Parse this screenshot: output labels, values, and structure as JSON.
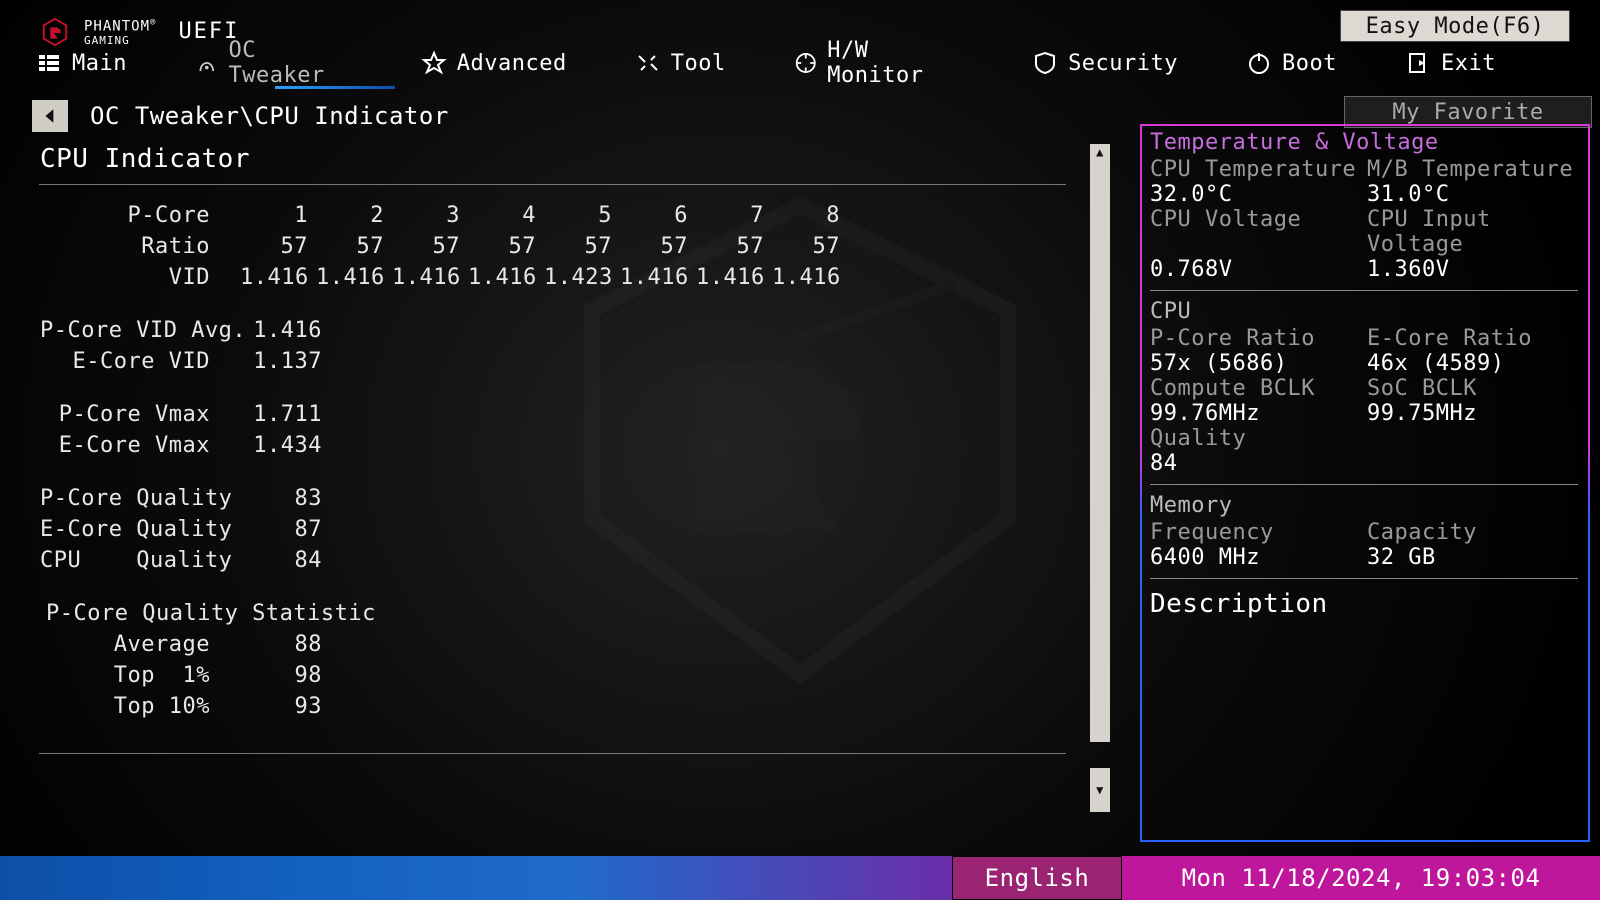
{
  "brand": {
    "line1": "PHANTOM",
    "line2": "GAMING",
    "uefi": "UEFI"
  },
  "easy_mode": "Easy Mode(F6)",
  "tabs": [
    {
      "label": "Main"
    },
    {
      "label": "OC Tweaker"
    },
    {
      "label": "Advanced"
    },
    {
      "label": "Tool"
    },
    {
      "label": "H/W Monitor"
    },
    {
      "label": "Security"
    },
    {
      "label": "Boot"
    },
    {
      "label": "Exit"
    }
  ],
  "active_tab_index": 1,
  "crumb": "OC Tweaker\\CPU Indicator",
  "my_favorite": "My Favorite",
  "section_title": "CPU Indicator",
  "pcore": {
    "header_label": "P-Core",
    "ratio_label": "Ratio",
    "vid_label": "VID",
    "indices": [
      "1",
      "2",
      "3",
      "4",
      "5",
      "6",
      "7",
      "8"
    ],
    "ratios": [
      "57",
      "57",
      "57",
      "57",
      "57",
      "57",
      "57",
      "57"
    ],
    "vids": [
      "1.416",
      "1.416",
      "1.416",
      "1.416",
      "1.423",
      "1.416",
      "1.416",
      "1.416"
    ]
  },
  "pairs": [
    {
      "label": "P-Core VID Avg.",
      "value": "1.416"
    },
    {
      "label": "E-Core VID",
      "value": "1.137"
    },
    {
      "_gap": true
    },
    {
      "label": "P-Core Vmax",
      "value": "1.711"
    },
    {
      "label": "E-Core Vmax",
      "value": "1.434"
    },
    {
      "_gap": true
    },
    {
      "label": "P-Core Quality",
      "value": "83"
    },
    {
      "label": "E-Core Quality",
      "value": "87"
    },
    {
      "label": "CPU    Quality",
      "value": "84"
    },
    {
      "_gap": true
    },
    {
      "label": "P-Core Quality Statistic",
      "value": ""
    },
    {
      "label": "Average",
      "value": "88"
    },
    {
      "label": "Top  1%",
      "value": "98"
    },
    {
      "label": "Top 10%",
      "value": "93"
    }
  ],
  "side": {
    "temp_volt_h": "Temperature & Voltage",
    "cpu_temp_k": "CPU Temperature",
    "cpu_temp_v": "32.0°C",
    "mb_temp_k": "M/B Temperature",
    "mb_temp_v": "31.0°C",
    "cpu_volt_k": "CPU Voltage",
    "cpu_volt_v": "0.768V",
    "cpu_involt_k": "CPU Input Voltage",
    "cpu_involt_v": "1.360V",
    "cpu_h": "CPU",
    "pcore_ratio_k": "P-Core Ratio",
    "pcore_ratio_v": "57x (5686)",
    "ecore_ratio_k": "E-Core Ratio",
    "ecore_ratio_v": "46x (4589)",
    "compute_bclk_k": "Compute BCLK",
    "compute_bclk_v": "99.76MHz",
    "soc_bclk_k": "SoC BCLK",
    "soc_bclk_v": "99.75MHz",
    "quality_k": "Quality",
    "quality_v": "84",
    "mem_h": "Memory",
    "freq_k": "Frequency",
    "freq_v": "6400 MHz",
    "cap_k": "Capacity",
    "cap_v": "32 GB",
    "desc_h": "Description"
  },
  "bottom": {
    "lang": "English",
    "datetime": "Mon 11/18/2024, 19:03:04"
  }
}
